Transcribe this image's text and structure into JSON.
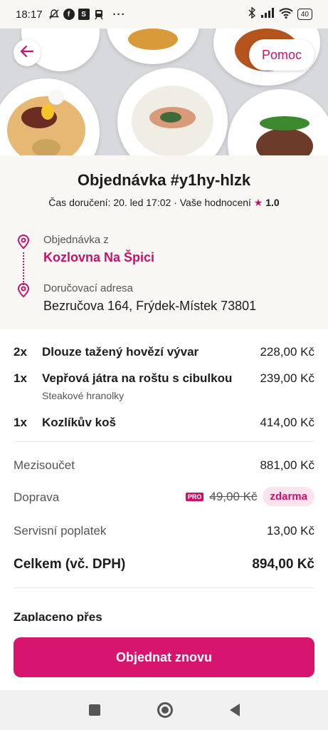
{
  "status_bar": {
    "time": "18:17",
    "notification_icons": [
      "muted-bell-icon",
      "facebook-icon",
      "s-app-icon",
      "train-icon"
    ],
    "more": "···",
    "battery": "40"
  },
  "header": {
    "back_icon": "arrow-left-icon",
    "help_label": "Pomoc"
  },
  "order": {
    "title": "Objednávka #y1hy-hlzk",
    "delivery_time": "Čas doručení: 20. led 17:02",
    "separator": "·",
    "rating_label": "Vaše hodnocení",
    "rating_value": "1.0"
  },
  "addresses": {
    "from_label": "Objednávka z",
    "from_value": "Kozlovna Na Špici",
    "to_label": "Doručovací adresa",
    "to_value": "Bezručova 164, Frýdek-Místek 73801"
  },
  "items": [
    {
      "qty": "2x",
      "name": "Dlouze tažený hovězí vývar",
      "price": "228,00 Kč",
      "note": ""
    },
    {
      "qty": "1x",
      "name": "Vepřová  játra na roštu s cibulkou",
      "price": "239,00 Kč",
      "note": "Steakové hranolky"
    },
    {
      "qty": "1x",
      "name": "Kozlíkův koš",
      "price": "414,00 Kč",
      "note": ""
    }
  ],
  "summary": {
    "subtotal_label": "Mezisoučet",
    "subtotal_value": "881,00 Kč",
    "delivery_label": "Doprava",
    "delivery_badge": "PRO",
    "delivery_original": "49,00 Kč",
    "delivery_value": "zdarma",
    "service_label": "Servisní poplatek",
    "service_value": "13,00 Kč",
    "total_label": "Celkem (vč. DPH)",
    "total_value": "894,00 Kč"
  },
  "payment": {
    "paid_label": "Zaplaceno přes"
  },
  "actions": {
    "order_again_label": "Objednat znovu"
  },
  "colors": {
    "accent": "#c8116a",
    "button": "#d7156e",
    "header_bg": "#f9f7f3"
  }
}
